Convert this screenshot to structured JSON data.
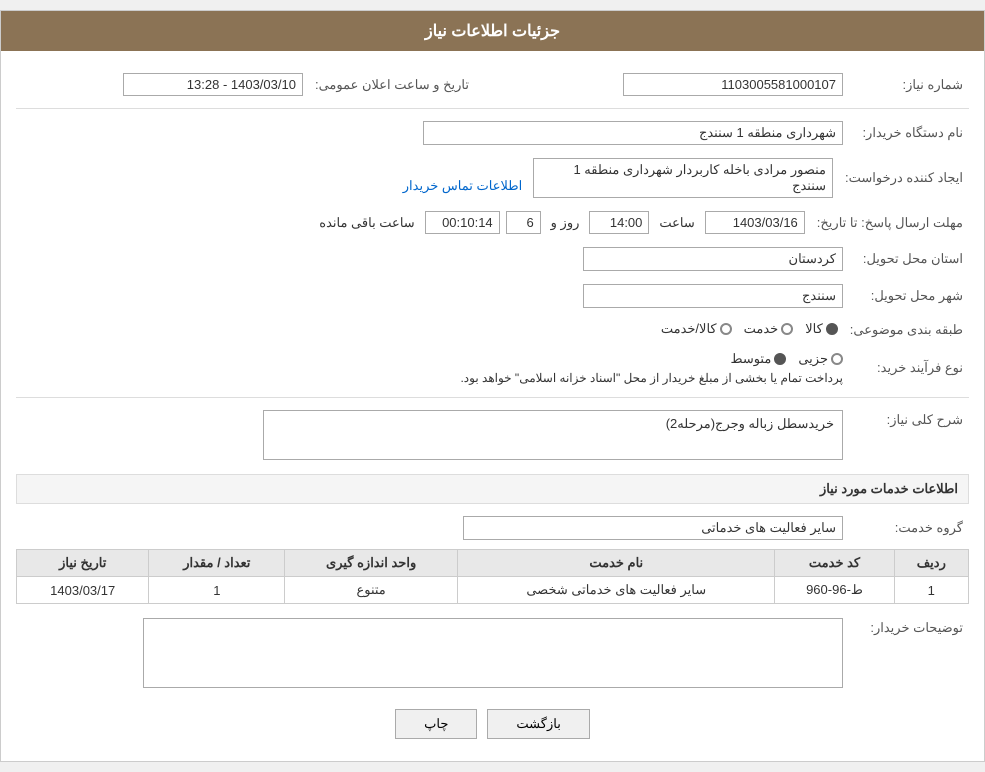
{
  "page": {
    "title": "جزئیات اطلاعات نیاز"
  },
  "header": {
    "announcement_label": "تاریخ و ساعت اعلان عمومی:",
    "announcement_value": "1403/03/10 - 13:28",
    "need_number_label": "شماره نیاز:",
    "need_number_value": "1103005581000107"
  },
  "fields": {
    "buyer_org_label": "نام دستگاه خریدار:",
    "buyer_org_value": "شهرداری منطقه 1 سنندج",
    "requester_label": "ایجاد کننده درخواست:",
    "requester_value": "منصور مرادی باخله کاربردار شهرداری منطقه 1 سنندج",
    "requester_link": "اطلاعات تماس خریدار",
    "deadline_label": "مهلت ارسال پاسخ: تا تاریخ:",
    "deadline_date": "1403/03/16",
    "deadline_time_label": "ساعت",
    "deadline_time": "14:00",
    "deadline_days_label": "روز و",
    "deadline_days": "6",
    "deadline_remaining_label": "ساعت باقی مانده",
    "deadline_remaining": "00:10:14",
    "province_label": "استان محل تحویل:",
    "province_value": "کردستان",
    "city_label": "شهر محل تحویل:",
    "city_value": "سنندج",
    "category_label": "طبقه بندی موضوعی:",
    "category_options": [
      {
        "label": "کالا",
        "selected": true
      },
      {
        "label": "خدمت",
        "selected": false
      },
      {
        "label": "کالا/خدمت",
        "selected": false
      }
    ],
    "purchase_type_label": "نوع فرآیند خرید:",
    "purchase_type_options": [
      {
        "label": "جزیی",
        "selected": false
      },
      {
        "label": "متوسط",
        "selected": true
      },
      {
        "label": "",
        "selected": false
      }
    ],
    "purchase_type_note": "پرداخت تمام یا بخشی از مبلغ خریدار از محل \"اسناد خزانه اسلامی\" خواهد بود.",
    "need_description_label": "شرح کلی نیاز:",
    "need_description_value": "خریدسطل زباله وجرج(مرحله2)"
  },
  "services_section": {
    "title": "اطلاعات خدمات مورد نیاز",
    "service_group_label": "گروه خدمت:",
    "service_group_value": "سایر فعالیت های خدماتی",
    "table_headers": [
      "ردیف",
      "کد خدمت",
      "نام خدمت",
      "واحد اندازه گیری",
      "تعداد / مقدار",
      "تاریخ نیاز"
    ],
    "table_rows": [
      {
        "row": "1",
        "code": "ط-96-960",
        "name": "سایر فعالیت های خدماتی شخصی",
        "unit": "متنوع",
        "quantity": "1",
        "date": "1403/03/17"
      }
    ]
  },
  "buyer_notes_label": "توضیحات خریدار:",
  "buyer_notes_value": "",
  "buttons": {
    "print_label": "چاپ",
    "back_label": "بازگشت"
  }
}
